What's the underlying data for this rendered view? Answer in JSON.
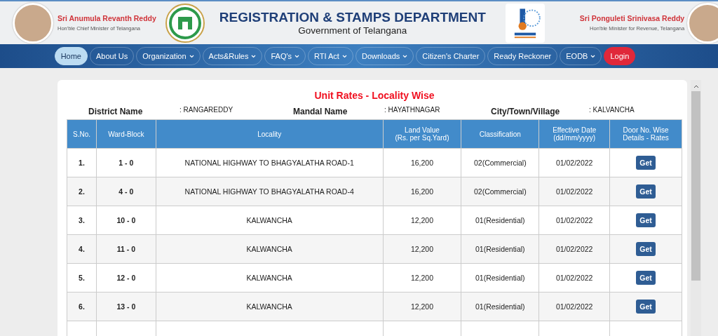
{
  "header": {
    "left_person": {
      "name": "Sri Anumula Revanth Reddy",
      "role": "Hon'ble Chief Minister of Telangana"
    },
    "title": "REGISTRATION & STAMPS DEPARTMENT",
    "subtitle": "Government of Telangana",
    "right_person": {
      "name": "Sri Ponguleti Srinivasa Reddy",
      "role": "Hon'ble Minister for Revenue, Telangana"
    }
  },
  "nav": [
    {
      "label": "Home",
      "kind": "link",
      "dropdown": false,
      "selected": true
    },
    {
      "label": "About Us",
      "kind": "link",
      "dropdown": false,
      "selected": false
    },
    {
      "label": "Organization",
      "kind": "link",
      "dropdown": true,
      "selected": false
    },
    {
      "label": "Acts&Rules",
      "kind": "link",
      "dropdown": true,
      "selected": false
    },
    {
      "label": "FAQ's",
      "kind": "link",
      "dropdown": true,
      "selected": false
    },
    {
      "label": "RTI Act",
      "kind": "link",
      "dropdown": true,
      "selected": false
    },
    {
      "label": "Downloads",
      "kind": "link",
      "dropdown": true,
      "selected": false
    },
    {
      "label": "Citizen's Charter",
      "kind": "link",
      "dropdown": false,
      "selected": false
    },
    {
      "label": "Ready Reckoner",
      "kind": "link",
      "dropdown": false,
      "selected": false
    },
    {
      "label": "EODB",
      "kind": "link",
      "dropdown": true,
      "selected": false
    },
    {
      "label": "Login",
      "kind": "login",
      "dropdown": false,
      "selected": false
    }
  ],
  "panel": {
    "title": "Unit Rates - Locality Wise",
    "filters": [
      {
        "label": "District Name",
        "value": ": RANGAREDDY"
      },
      {
        "label": "Mandal Name",
        "value": ": HAYATHNAGAR"
      },
      {
        "label": "City/Town/Village",
        "value": ": KALVANCHA"
      }
    ],
    "table": {
      "columns": [
        "S.No.",
        "Ward-Block",
        "Locality",
        "Land Value\n(Rs. per Sq.Yard)",
        "Classification",
        "Effective Date\n(dd/mm/yyyy)",
        "Door No. Wise\nDetails - Rates"
      ],
      "rows": [
        {
          "cells": [
            "1.",
            "1 - 0",
            "NATIONAL HIGHWAY TO BHAGYALATHA ROAD-1",
            "16,200",
            "02(Commercial)",
            "01/02/2022"
          ],
          "action": "Get"
        },
        {
          "cells": [
            "2.",
            "4 - 0",
            "NATIONAL HIGHWAY TO BHAGYALATHA ROAD-4",
            "16,200",
            "02(Commercial)",
            "01/02/2022"
          ],
          "action": "Get"
        },
        {
          "cells": [
            "3.",
            "10 - 0",
            "KALWANCHA",
            "12,200",
            "01(Residential)",
            "01/02/2022"
          ],
          "action": "Get"
        },
        {
          "cells": [
            "4.",
            "11 - 0",
            "KALWANCHA",
            "12,200",
            "01(Residential)",
            "01/02/2022"
          ],
          "action": "Get"
        },
        {
          "cells": [
            "5.",
            "12 - 0",
            "KALWANCHA",
            "12,200",
            "01(Residential)",
            "01/02/2022"
          ],
          "action": "Get"
        },
        {
          "cells": [
            "6.",
            "13 - 0",
            "KALWANCHA",
            "12,200",
            "01(Residential)",
            "01/02/2022"
          ],
          "action": "Get"
        }
      ]
    }
  }
}
